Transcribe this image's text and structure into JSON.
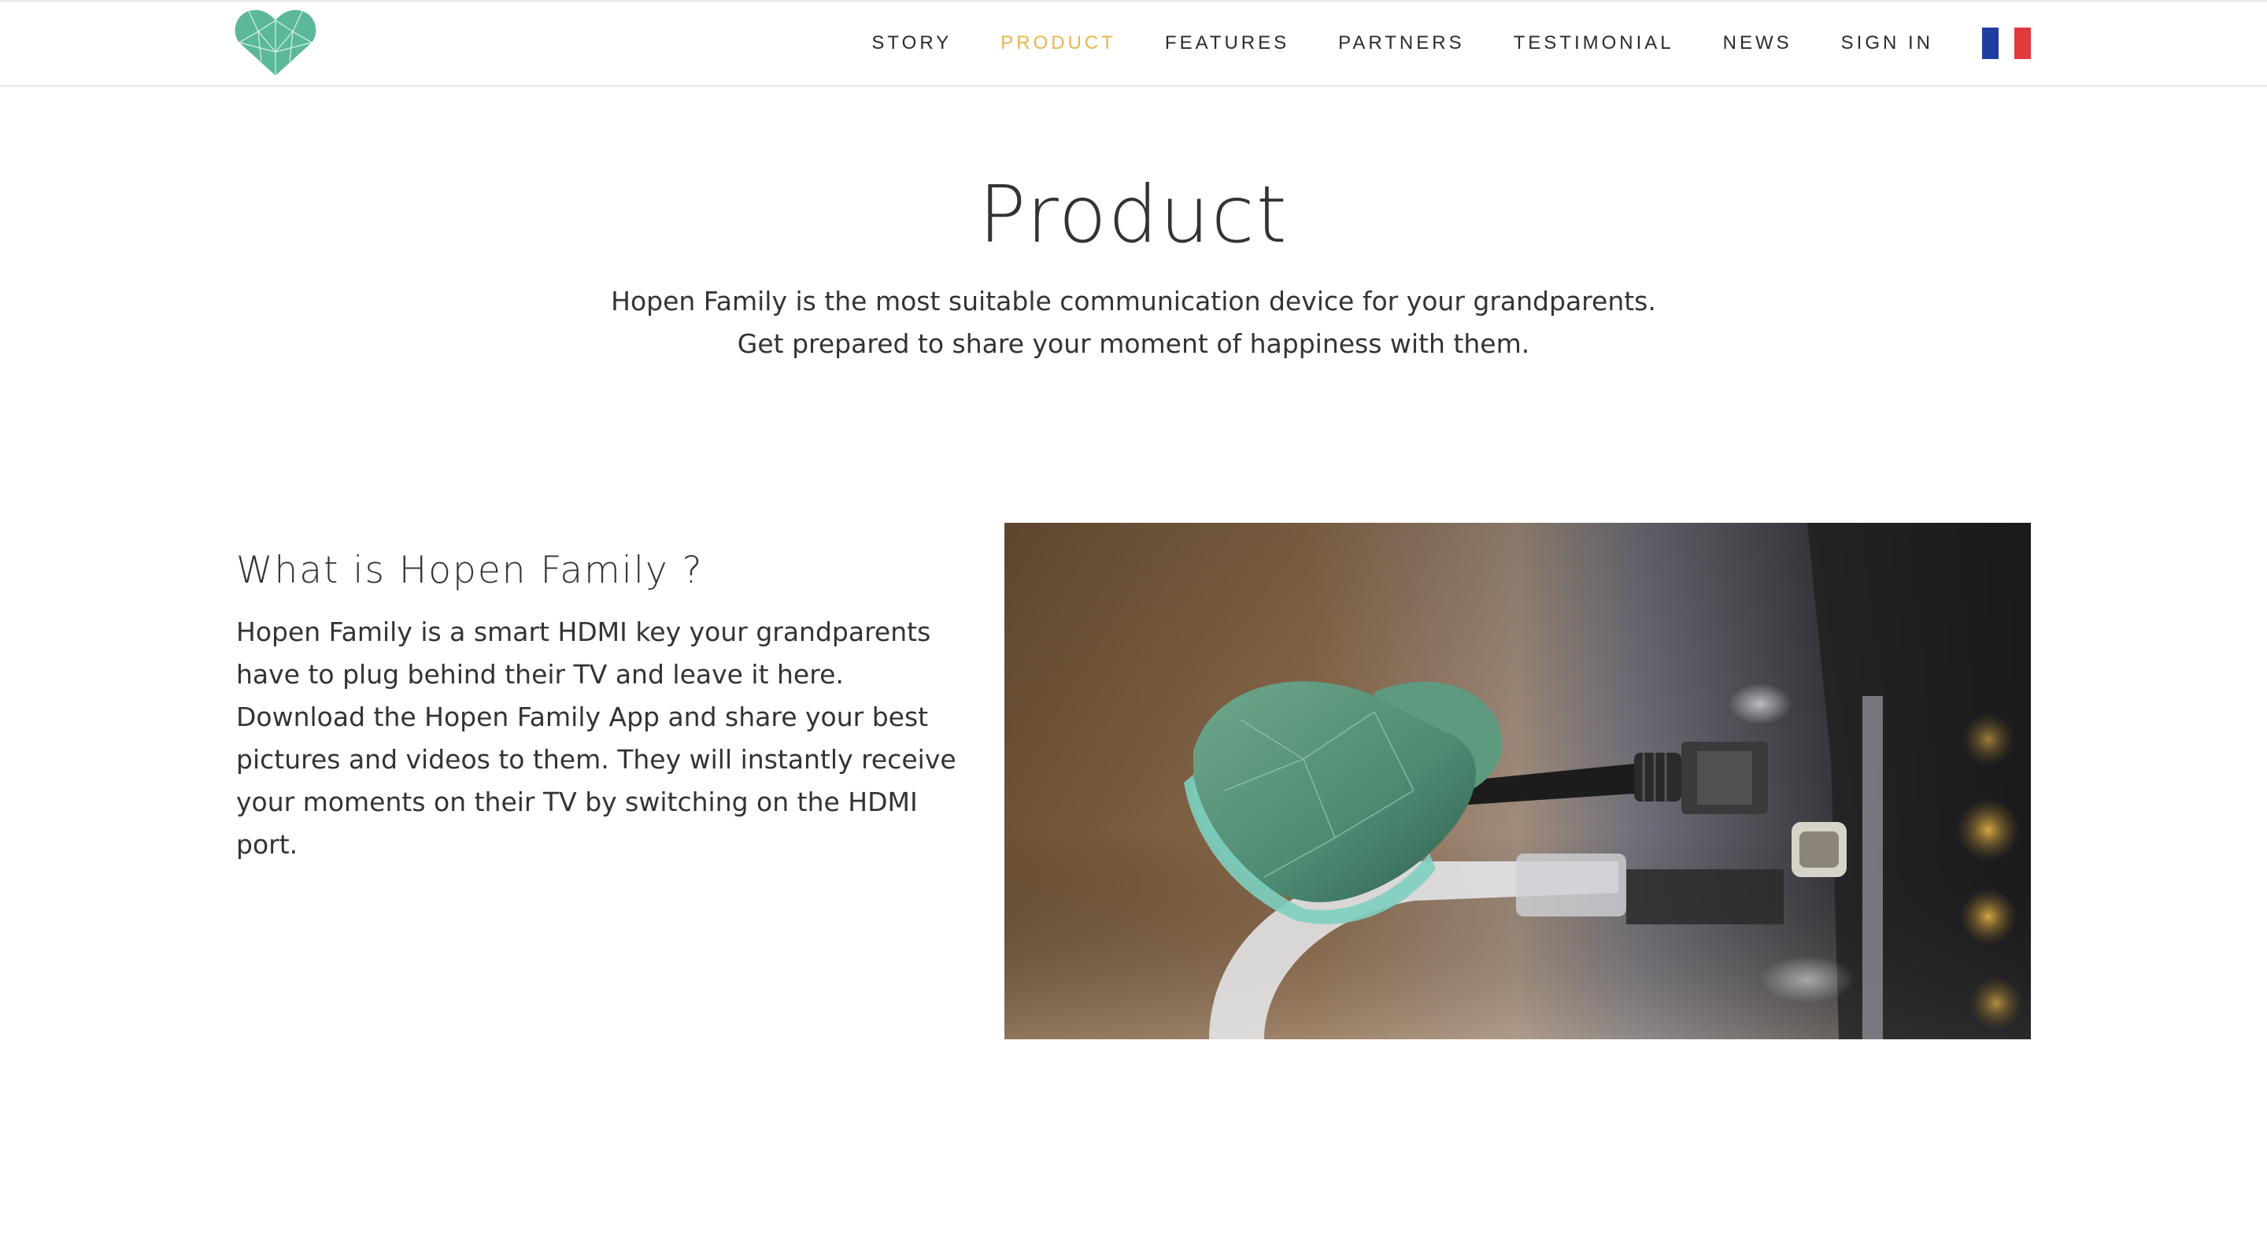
{
  "nav": {
    "items": [
      {
        "label": "STORY",
        "active": false
      },
      {
        "label": "PRODUCT",
        "active": true
      },
      {
        "label": "FEATURES",
        "active": false
      },
      {
        "label": "PARTNERS",
        "active": false
      },
      {
        "label": "TESTIMONIAL",
        "active": false
      },
      {
        "label": "NEWS",
        "active": false
      },
      {
        "label": "SIGN IN",
        "active": false
      }
    ],
    "flag_icon": "french-flag-icon"
  },
  "hero": {
    "title": "Product",
    "subtitle_line1": "Hopen Family is the most suitable communication device for your grandparents.",
    "subtitle_line2": "Get prepared to share your moment of happiness with them."
  },
  "section": {
    "title": "What is Hopen Family ?",
    "body": "Hopen Family is a smart HDMI key your grandparents have to plug behind their TV and leave it here. Download the Hopen Family App and share your best pictures and videos to them. They will instantly receive your moments on their TV by switching on the HDMI port."
  },
  "colors": {
    "accent": "#e9b64c",
    "brand_green": "#5bb89a",
    "text": "#333333"
  }
}
